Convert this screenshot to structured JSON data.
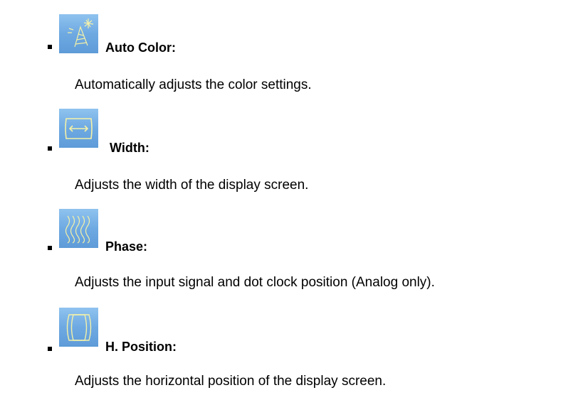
{
  "items": [
    {
      "icon": "auto-color-icon",
      "label": "Auto Color:",
      "description": "Automatically adjusts the color settings."
    },
    {
      "icon": "width-icon",
      "label": "Width:",
      "description": "Adjusts the width of the display screen."
    },
    {
      "icon": "phase-icon",
      "label": "Phase:",
      "description": "Adjusts the input signal and dot clock position (Analog only)."
    },
    {
      "icon": "h-position-icon",
      "label": "H. Position:",
      "description": "Adjusts the horizontal position of the display screen."
    }
  ],
  "colors": {
    "icon_background": "#6ea9e2",
    "icon_stroke": "#f4f1a8"
  }
}
